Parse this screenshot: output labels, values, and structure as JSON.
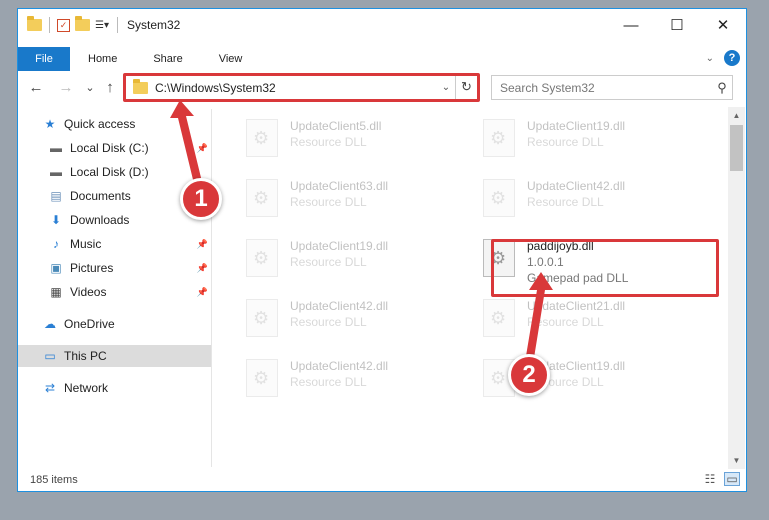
{
  "window": {
    "title": "System32",
    "controls": {
      "minimize": "—",
      "maximize": "☐",
      "close": "✕"
    }
  },
  "ribbon": {
    "tabs": [
      "File",
      "Home",
      "Share",
      "View"
    ]
  },
  "address_bar": {
    "path": "C:\\Windows\\System32",
    "refresh_glyph": "↻"
  },
  "search": {
    "placeholder": "Search System32"
  },
  "navigation": {
    "back": "←",
    "forward": "→",
    "recent": "⌄",
    "up": "↑"
  },
  "nav_pane": {
    "quick_access": "Quick access",
    "items": [
      {
        "label": "Local Disk (C:)",
        "icon": "drive-icon"
      },
      {
        "label": "Local Disk (D:)",
        "icon": "drive-icon"
      },
      {
        "label": "Documents",
        "icon": "documents-icon"
      },
      {
        "label": "Downloads",
        "icon": "downloads-icon"
      },
      {
        "label": "Music",
        "icon": "music-icon"
      },
      {
        "label": "Pictures",
        "icon": "pictures-icon"
      },
      {
        "label": "Videos",
        "icon": "videos-icon"
      }
    ],
    "onedrive": "OneDrive",
    "this_pc": "This PC",
    "network": "Network"
  },
  "files": [
    {
      "name": "UpdateClient5.dll",
      "sub1": "Resource DLL",
      "sub2": "",
      "faded": true
    },
    {
      "name": "UpdateClient19.dll",
      "sub1": "Resource DLL",
      "sub2": "",
      "faded": true
    },
    {
      "name": "UpdateClient63.dll",
      "sub1": "Resource DLL",
      "sub2": "",
      "faded": true
    },
    {
      "name": "UpdateClient42.dll",
      "sub1": "Resource DLL",
      "sub2": "",
      "faded": true
    },
    {
      "name": "UpdateClient19.dll",
      "sub1": "Resource DLL",
      "sub2": "",
      "faded": true
    },
    {
      "name": "paddijoyb.dll",
      "sub1": "1.0.0.1",
      "sub2": "Gamepad pad DLL",
      "faded": false
    },
    {
      "name": "UpdateClient42.dll",
      "sub1": "Resource DLL",
      "sub2": "",
      "faded": true
    },
    {
      "name": "UpdateClient21.dll",
      "sub1": "Resource DLL",
      "sub2": "",
      "faded": true
    },
    {
      "name": "UpdateClient42.dll",
      "sub1": "Resource DLL",
      "sub2": "",
      "faded": true
    },
    {
      "name": "UpdateClient19.dll",
      "sub1": "Resource DLL",
      "sub2": "",
      "faded": true
    }
  ],
  "status": {
    "item_count": "185 items"
  },
  "annotations": {
    "step1": "1",
    "step2": "2",
    "color": "#d9383a"
  }
}
